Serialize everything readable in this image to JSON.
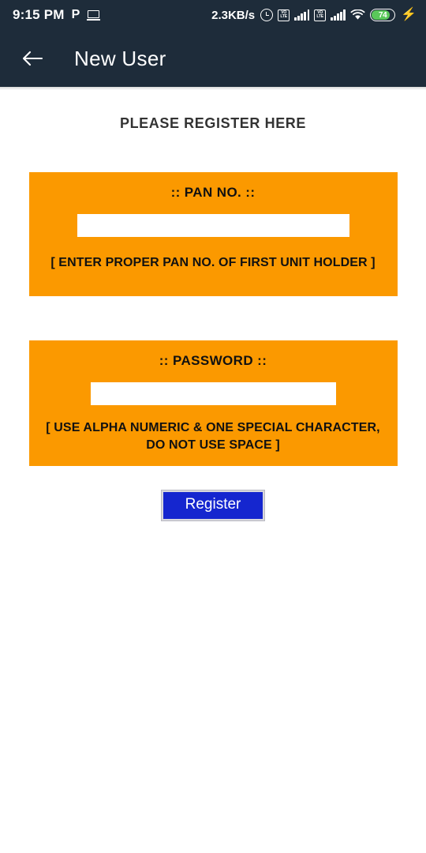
{
  "status_bar": {
    "clock": "9:15 PM",
    "left_icons": [
      {
        "name": "paytm-icon",
        "glyph": "P"
      },
      {
        "name": "laptop-icon",
        "glyph": "laptop"
      }
    ],
    "network_speed": "2.3KB/s",
    "right_icons": [
      {
        "name": "alarm-icon"
      },
      {
        "name": "volte-icon-sim1",
        "top": "VO",
        "bottom": "LTE"
      },
      {
        "name": "signal-bars-icon-sim1"
      },
      {
        "name": "volte-icon-sim2",
        "top": "VO",
        "bottom": "LTE"
      },
      {
        "name": "signal-bars-icon-sim2"
      },
      {
        "name": "wifi-icon"
      }
    ],
    "battery": {
      "level": "74",
      "charging_glyph": "⚡",
      "fill_color": "#5ac85a"
    }
  },
  "app_bar": {
    "back_label": "back-arrow",
    "title": "New User",
    "background_color": "#1e2c3a"
  },
  "main": {
    "heading": "PLEASE REGISTER HERE",
    "accent_color": "#fb9900",
    "pan_panel": {
      "label": ":: PAN NO. ::",
      "input_value": "",
      "input_placeholder": "",
      "hint": "[ ENTER PROPER PAN NO. OF FIRST UNIT HOLDER ]"
    },
    "password_panel": {
      "label": ":: PASSWORD ::",
      "input_value": "",
      "input_placeholder": "",
      "hint_line1": "[ USE ALPHA NUMERIC & ONE SPECIAL CHARACTER,",
      "hint_line2": "DO NOT USE SPACE ]"
    },
    "register_button": {
      "label": "Register",
      "color": "#1526cf"
    }
  }
}
